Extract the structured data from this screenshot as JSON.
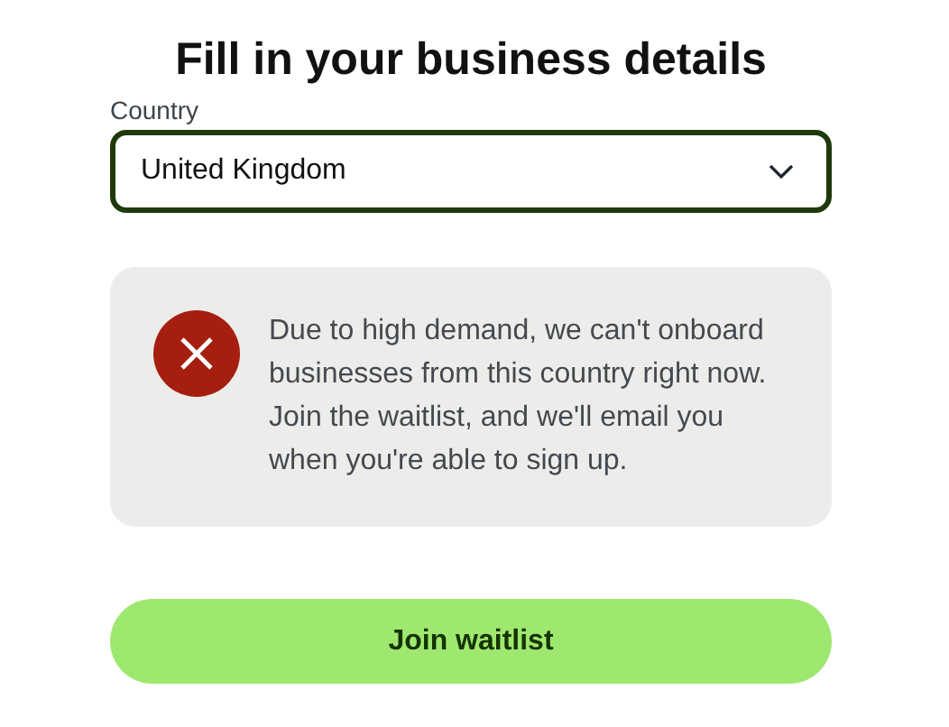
{
  "title": "Fill in your business details",
  "country_field": {
    "label": "Country",
    "value": "United Kingdom"
  },
  "notice": {
    "kind": "error",
    "message": "Due to high demand, we can't onboard businesses from this country right now. Join the waitlist, and we'll email you when you're able to sign up."
  },
  "buttons": [
    "Join waitlist"
  ]
}
